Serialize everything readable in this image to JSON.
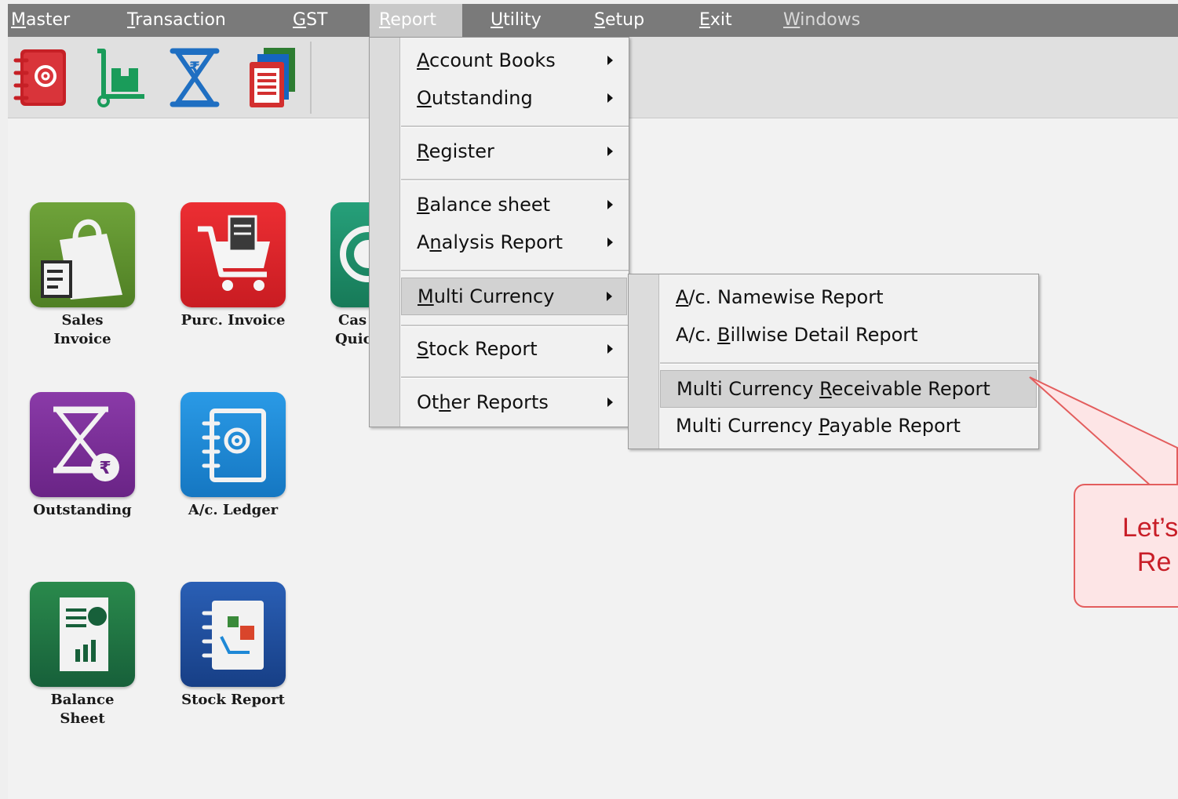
{
  "menubar": {
    "items": [
      {
        "label": "Master",
        "ul": "M"
      },
      {
        "label": "Transaction",
        "ul": "T"
      },
      {
        "label": "GST",
        "ul": "G"
      },
      {
        "label": "Report",
        "ul": "R"
      },
      {
        "label": "Utility",
        "ul": "U"
      },
      {
        "label": "Setup",
        "ul": "S"
      },
      {
        "label": "Exit",
        "ul": "E"
      },
      {
        "label": "Windows",
        "ul": "W"
      }
    ]
  },
  "toolbar": {
    "icons": [
      "contacts-book-icon",
      "stock-trolley-icon",
      "hourglass-rupee-icon",
      "report-stack-icon"
    ]
  },
  "tiles": [
    {
      "line1": "Sales",
      "line2": "Invoice",
      "icon": "shopping-bag-icon",
      "color": "#5f8f2f"
    },
    {
      "line1": "Purc. Invoice",
      "line2": "",
      "icon": "cart-icon",
      "color": "#d9232b"
    },
    {
      "line1": "Cas",
      "line2": "Quic",
      "icon": "cash-icon",
      "color": "#1f8a6a"
    },
    {
      "line1": "Outstanding",
      "line2": "",
      "icon": "hourglass-icon",
      "color": "#7a3296"
    },
    {
      "line1": "A/c. Ledger",
      "line2": "",
      "icon": "ledger-icon",
      "color": "#1e88d6"
    },
    {
      "line1": "Balance",
      "line2": "Sheet",
      "icon": "balance-sheet-icon",
      "color": "#1f6e3c"
    },
    {
      "line1": "Stock Report",
      "line2": "",
      "icon": "stock-report-icon",
      "color": "#1d4fa0"
    }
  ],
  "report_menu": {
    "items": [
      {
        "pre": "",
        "ul": "A",
        "post": "ccount Books"
      },
      {
        "pre": "",
        "ul": "O",
        "post": "utstanding"
      },
      {
        "pre": "",
        "ul": "R",
        "post": "egister"
      },
      {
        "pre": "",
        "ul": "B",
        "post": "alance sheet"
      },
      {
        "pre": "A",
        "ul": "n",
        "post": "alysis Report"
      },
      {
        "pre": "",
        "ul": "M",
        "post": "ulti Currency"
      },
      {
        "pre": "",
        "ul": "S",
        "post": "tock Report"
      },
      {
        "pre": "Ot",
        "ul": "h",
        "post": "er Reports"
      }
    ]
  },
  "multi_currency_menu": {
    "items": [
      {
        "pre": "",
        "ul": "A",
        "post": "/c. Namewise Report"
      },
      {
        "pre": "A/c. ",
        "ul": "B",
        "post": "illwise Detail Report"
      },
      {
        "pre": "Multi Currency ",
        "ul": "R",
        "post": "eceivable Report"
      },
      {
        "pre": "Multi Currency ",
        "ul": "P",
        "post": "ayable Report"
      }
    ]
  },
  "callout": {
    "text": "Let’s\n  Re",
    "border_color": "#e35d5d",
    "text_color": "#c81e28"
  }
}
